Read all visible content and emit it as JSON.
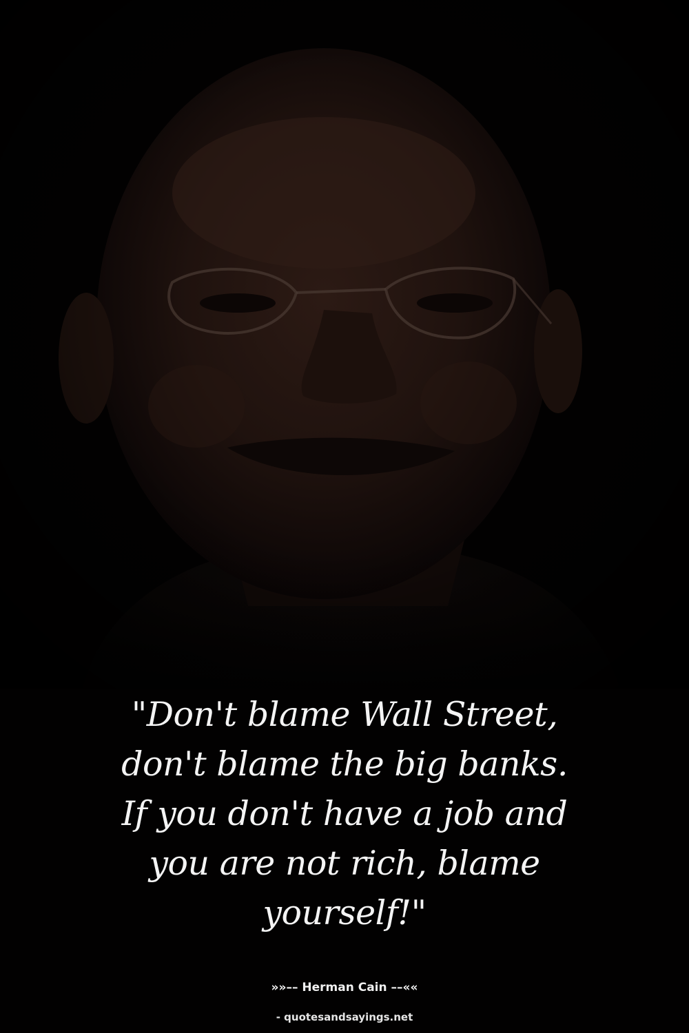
{
  "quote": {
    "lines": [
      "\"Don't blame Wall Street,",
      "don't blame the big banks.",
      "If you don't have a job and",
      "you are not rich, blame",
      "yourself!\""
    ]
  },
  "author": "»»–– Herman Cain ––««",
  "source": "- quotesandsayings.net",
  "colors": {
    "background": "#020101",
    "text": "#f4f4f4"
  }
}
